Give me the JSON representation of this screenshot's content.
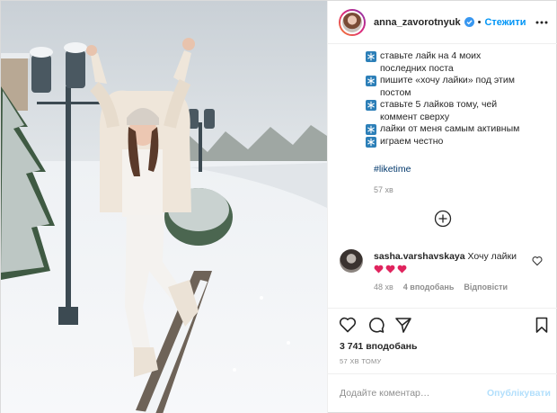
{
  "header": {
    "username": "anna_zavorotnyuk",
    "separator": "•",
    "follow_label": "Стежити",
    "more_icon": "more-options-icon",
    "verified_icon": "verified-badge-icon"
  },
  "caption": {
    "lines": [
      {
        "text": "ставьте лайк на 4 моих",
        "cont": "последних поста"
      },
      {
        "text": "пишите «хочу лайки» под этим",
        "cont": "постом"
      },
      {
        "text": "ставьте 5 лайков тому, чей",
        "cont": "коммент сверху"
      },
      {
        "text": "лайки от меня самым активным",
        "cont": ""
      },
      {
        "text": "играем честно",
        "cont": ""
      }
    ],
    "hashtag": "#liketime",
    "time": "57 хв",
    "bullet_icon": "snowflake-icon"
  },
  "comment": {
    "username": "sasha.varshavskaya",
    "text": "Хочу лайки",
    "time": "48 хв",
    "likes": "4 вподобань",
    "reply": "Відповісти"
  },
  "actions": {
    "likes_count": "3 741 вподобань",
    "post_time": "57 ХВ ТОМУ"
  },
  "add_comment": {
    "placeholder": "Додайте коментар…",
    "publish_label": "Опублікувати"
  },
  "colors": {
    "accent": "#0095f6",
    "publish_disabled": "#b2dffc",
    "heart_red": "#e0245e",
    "muted": "#8e8e8e"
  }
}
